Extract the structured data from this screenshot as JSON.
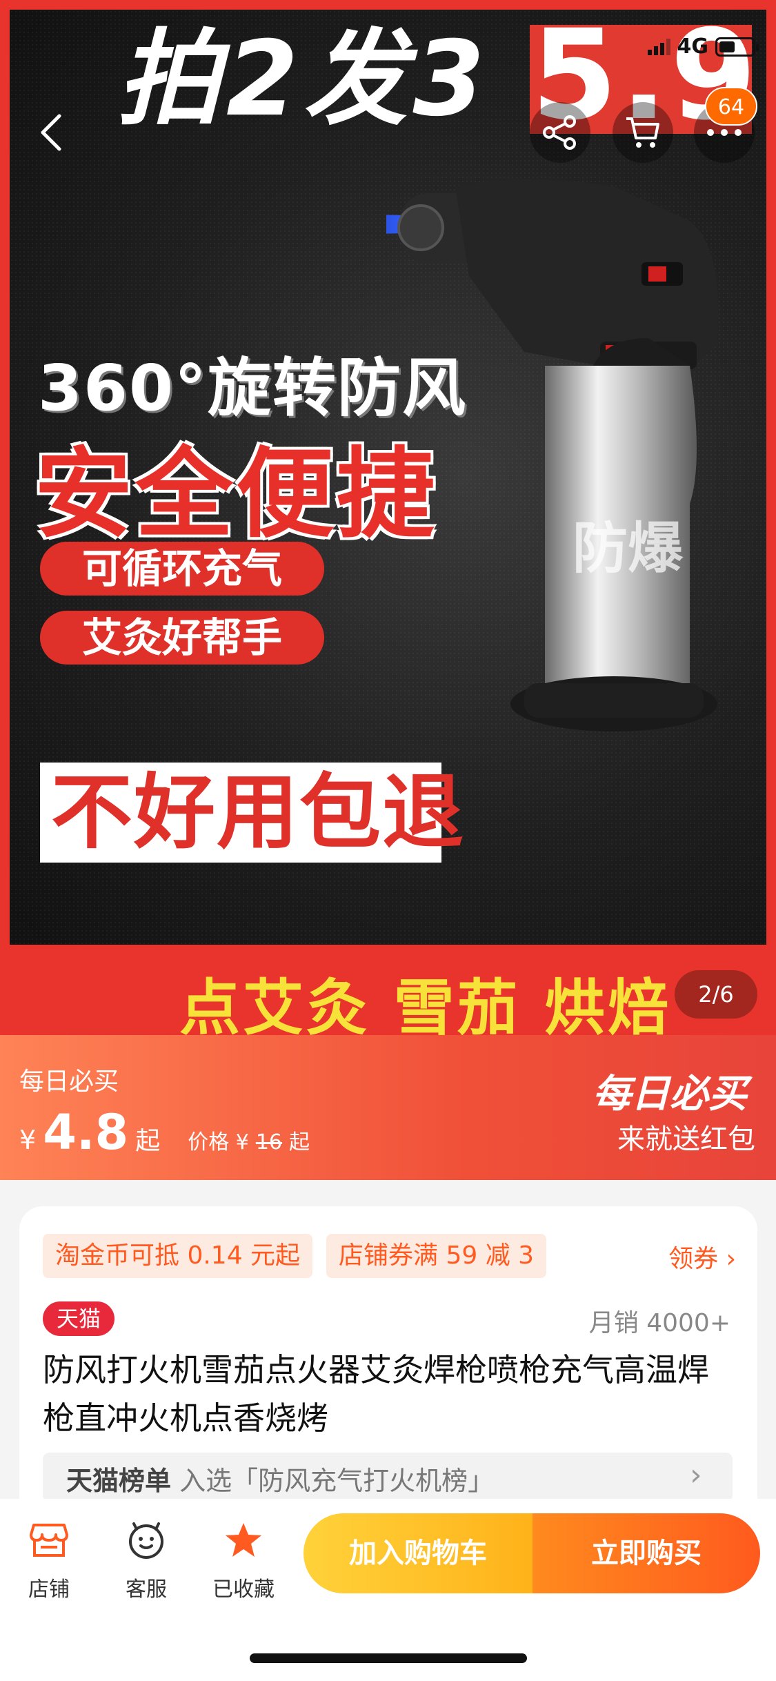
{
  "status_bar": {
    "network": "4G"
  },
  "hero": {
    "headline": "拍2发3",
    "price_big": "5.9",
    "feature_line1": "360°旋转防风",
    "feature_line2": "安全便捷",
    "pill1": "可循环充气",
    "pill2": "艾灸好帮手",
    "refund": "不好用包退",
    "watermark": "防爆",
    "bottom_text": "点艾灸 雪茄 烘焙",
    "page_indicator": "2/6"
  },
  "nav": {
    "cart_badge": "64"
  },
  "promo": {
    "label": "每日必买",
    "currency": "¥",
    "price": "4.8",
    "price_suffix": "起",
    "orig_label": "价格 ¥",
    "orig_price": "16",
    "orig_suffix": "起",
    "right_title": "每日必买",
    "right_sub": "来就送红包"
  },
  "product": {
    "chip1": "淘金币可抵 0.14 元起",
    "chip2": "店铺券满 59 减 3",
    "coupon_link": "领券 ›",
    "tmall": "天猫",
    "sales": "月销 4000+",
    "title": "防风打火机雪茄点火器艾灸焊枪喷枪充气高温焊枪直冲火机点香烧烤",
    "rank_label": "天猫榜单",
    "rank_text": " 入选「防风充气打火机榜」"
  },
  "bottom_bar": {
    "shop": "店铺",
    "service": "客服",
    "favorited": "已收藏",
    "add_cart": "加入购物车",
    "buy_now": "立即购买"
  },
  "colors": {
    "brand_red": "#e8342c",
    "accent_orange": "#ff5a20",
    "cart_yellow": "#ffd23a",
    "buy_orange": "#ff5a1e"
  }
}
